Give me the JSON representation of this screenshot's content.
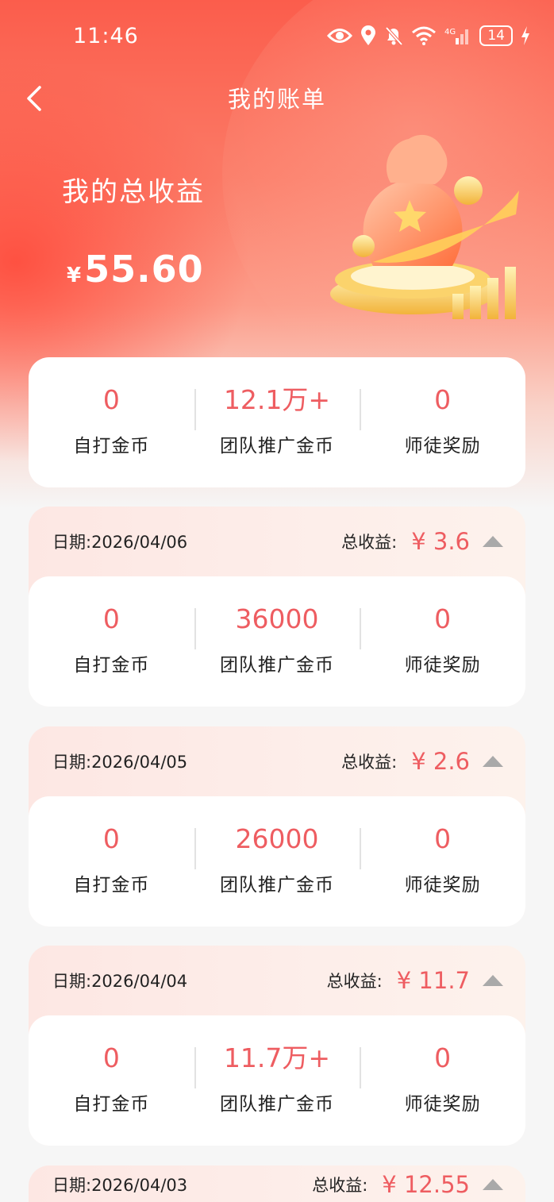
{
  "status_bar": {
    "time": "11:46",
    "battery": "14"
  },
  "nav": {
    "title": "我的账单"
  },
  "total": {
    "label": "我的总收益",
    "currency": "¥",
    "amount": "55.60"
  },
  "summary": {
    "stats": [
      {
        "value": "0",
        "label": "自打金币"
      },
      {
        "value": "12.1万+",
        "label": "团队推广金币"
      },
      {
        "value": "0",
        "label": "师徒奖励"
      }
    ]
  },
  "days": [
    {
      "date": "日期:2026/04/06",
      "total_label": "总收益:",
      "total_amount": "¥ 3.6",
      "stats": [
        {
          "value": "0",
          "label": "自打金币"
        },
        {
          "value": "36000",
          "label": "团队推广金币"
        },
        {
          "value": "0",
          "label": "师徒奖励"
        }
      ]
    },
    {
      "date": "日期:2026/04/05",
      "total_label": "总收益:",
      "total_amount": "¥ 2.6",
      "stats": [
        {
          "value": "0",
          "label": "自打金币"
        },
        {
          "value": "26000",
          "label": "团队推广金币"
        },
        {
          "value": "0",
          "label": "师徒奖励"
        }
      ]
    },
    {
      "date": "日期:2026/04/04",
      "total_label": "总收益:",
      "total_amount": "¥ 11.7",
      "stats": [
        {
          "value": "0",
          "label": "自打金币"
        },
        {
          "value": "11.7万+",
          "label": "团队推广金币"
        },
        {
          "value": "0",
          "label": "师徒奖励"
        }
      ]
    },
    {
      "date": "日期:2026/04/03",
      "total_label": "总收益:",
      "total_amount": "¥ 12.55"
    }
  ],
  "icons": {
    "back": "chevron-left-icon",
    "toggle": "triangle-up-icon"
  },
  "colors": {
    "accent": "#ee5d61",
    "header": "#fb5d4c",
    "toggle": "#a9a9a9"
  }
}
